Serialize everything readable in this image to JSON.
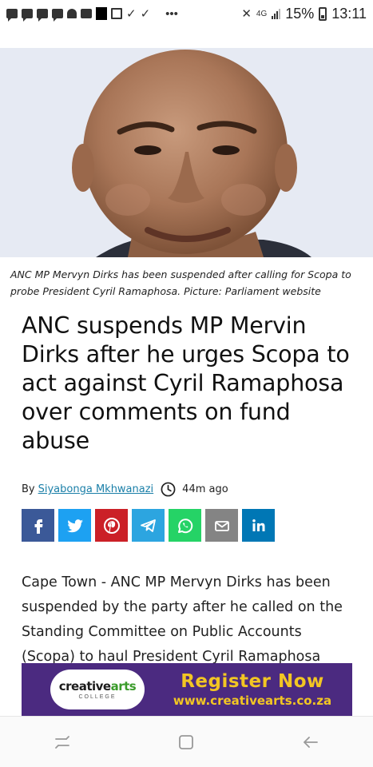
{
  "status_bar": {
    "battery": "15%",
    "time": "13:11",
    "network": "4G"
  },
  "article": {
    "caption": "ANC MP Mervyn Dirks has been suspended after calling for Scopa to probe President Cyril Ramaphosa. Picture: Parliament website",
    "headline": "ANC suspends MP Mervin Dirks after he urges Scopa to act against Cyril Ramaphosa over comments on fund abuse",
    "byline_prefix": "By",
    "author": "Siyabonga Mkhwanazi",
    "time_ago": "44m ago",
    "body": "Cape Town - ANC MP Mervyn Dirks has been suspended by the party after he called on the Standing Committee on Public Accounts (Scopa) to haul President Cyril Ramaphosa"
  },
  "share_buttons": [
    {
      "name": "facebook",
      "color": "#3b5998",
      "icon": "facebook-icon"
    },
    {
      "name": "twitter",
      "color": "#1da1f2",
      "icon": "twitter-icon"
    },
    {
      "name": "pinterest",
      "color": "#cb2027",
      "icon": "pinterest-icon"
    },
    {
      "name": "telegram",
      "color": "#2ca5e0",
      "icon": "telegram-icon"
    },
    {
      "name": "whatsapp",
      "color": "#25d366",
      "icon": "whatsapp-icon"
    },
    {
      "name": "email",
      "color": "#848484",
      "icon": "email-icon"
    },
    {
      "name": "linkedin",
      "color": "#0077b5",
      "icon": "linkedin-icon"
    }
  ],
  "ad": {
    "logo_main_1": "creative",
    "logo_main_2": "arts",
    "logo_sub": "COLLEGE",
    "cta": "Register Now",
    "url": "www.creativearts.co.za",
    "background": "#4b2a80",
    "accent": "#f2c623"
  },
  "nav_bar": {
    "buttons": [
      "recent-apps-icon",
      "home-icon",
      "back-icon"
    ]
  }
}
